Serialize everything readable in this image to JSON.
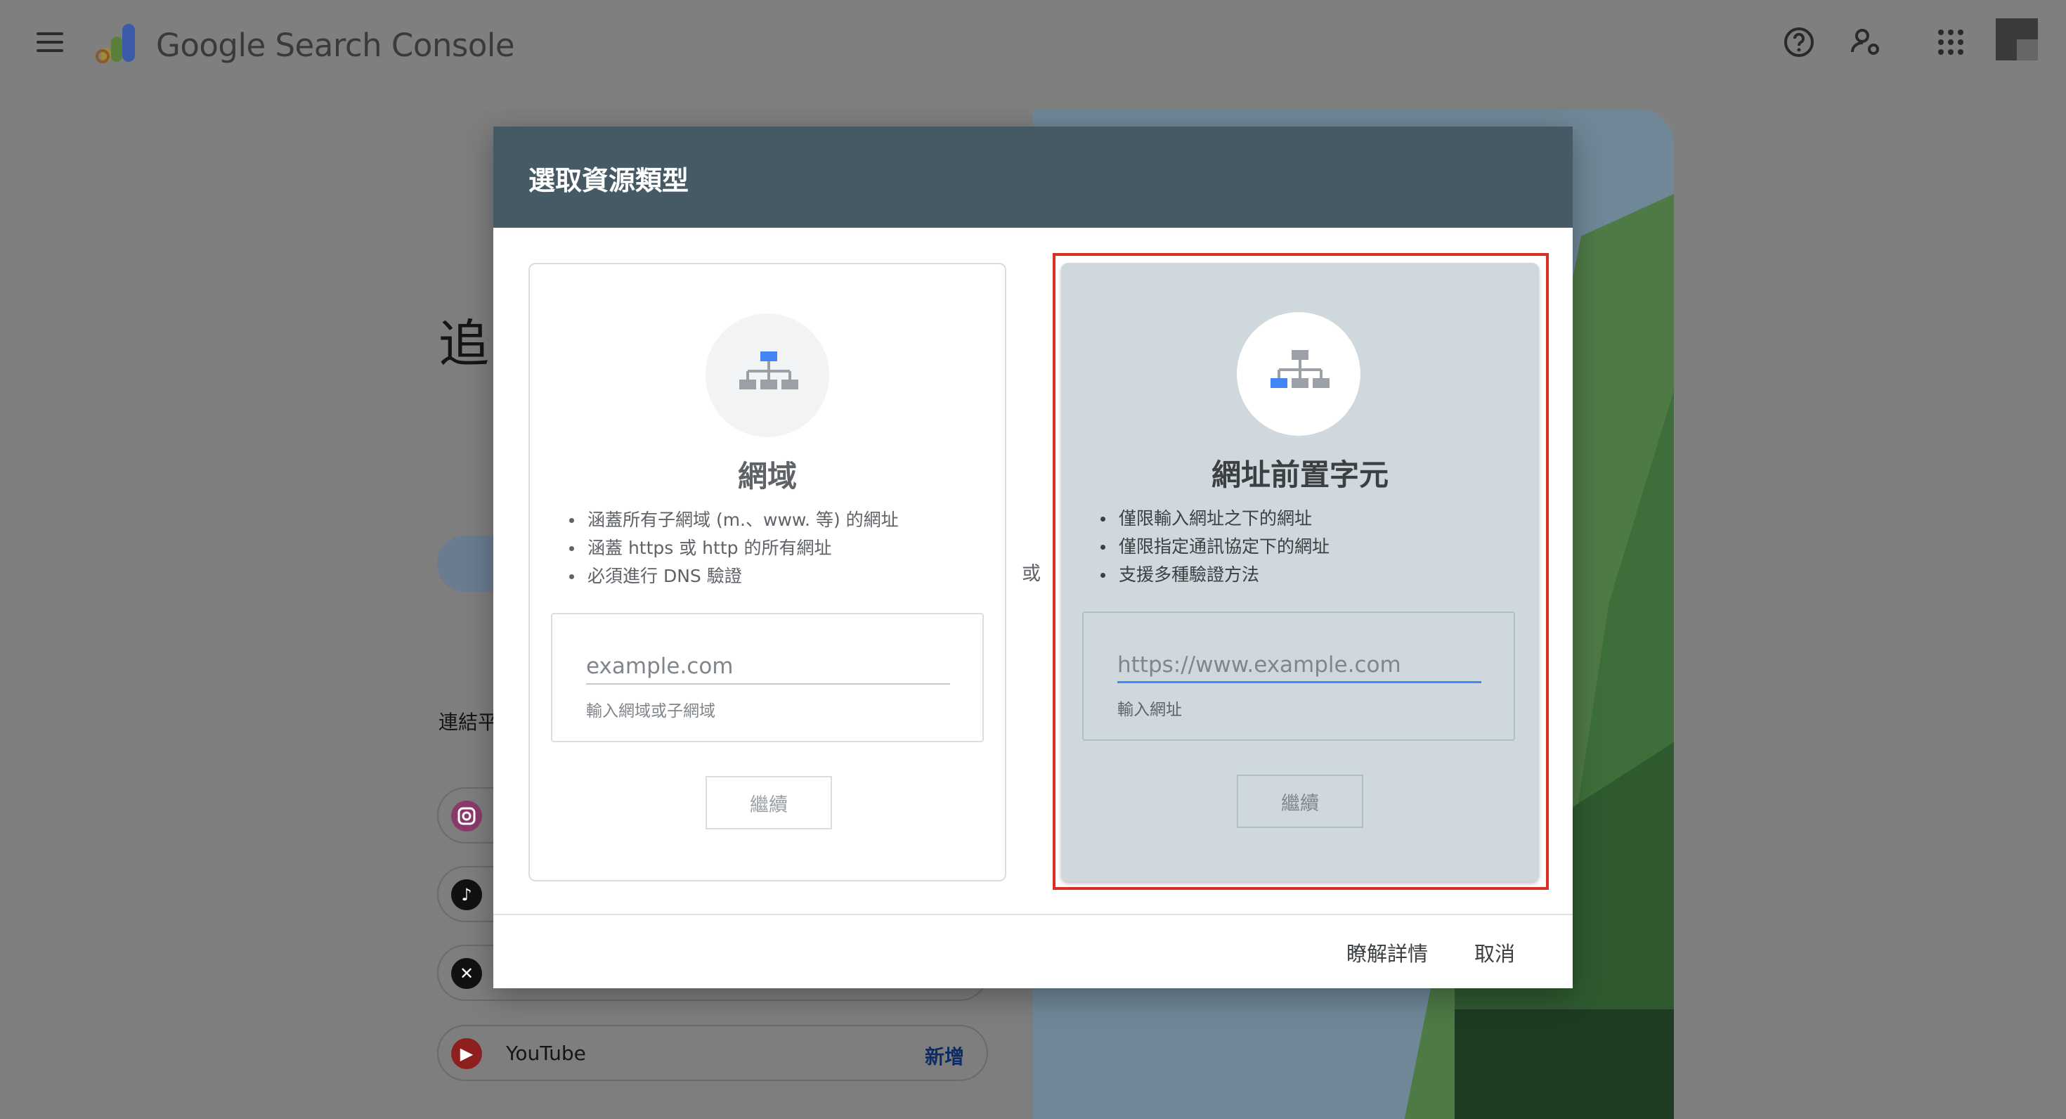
{
  "app": {
    "title": "Google Search Console",
    "icons": [
      "menu-icon",
      "help-icon",
      "manage-accounts-icon",
      "apps-icon",
      "avatar"
    ]
  },
  "background": {
    "heading": "追",
    "connect_label": "連結平",
    "social_rows": [
      {
        "icon": "instagram-icon",
        "name": "",
        "action": ""
      },
      {
        "icon": "tiktok-icon",
        "name": "",
        "action": ""
      },
      {
        "icon": "x-icon",
        "name": "",
        "action": ""
      },
      {
        "icon": "youtube-icon",
        "name": "YouTube",
        "action": "新增"
      }
    ]
  },
  "dialog": {
    "title": "選取資源類型",
    "or_label": "或",
    "domain": {
      "title": "網域",
      "bullets": [
        "涵蓋所有子網域 (m.、www. 等) 的網址",
        "涵蓋 https 或 http 的所有網址",
        "必須進行 DNS 驗證"
      ],
      "input_placeholder": "example.com",
      "input_value": "",
      "helper": "輸入網域或子網域",
      "continue_label": "繼續"
    },
    "url_prefix": {
      "title": "網址前置字元",
      "bullets": [
        "僅限輸入網址之下的網址",
        "僅限指定通訊協定下的網址",
        "支援多種驗證方法"
      ],
      "input_placeholder": "https://www.example.com",
      "input_value": "",
      "helper": "輸入網址",
      "continue_label": "繼續",
      "highlighted": true
    },
    "footer": {
      "learn_more": "瞭解詳情",
      "cancel": "取消"
    }
  },
  "colors": {
    "dialog_header": "#455a64",
    "selected_card": "#cfd8dc",
    "highlight": "#d93025",
    "accent": "#4285f4"
  }
}
